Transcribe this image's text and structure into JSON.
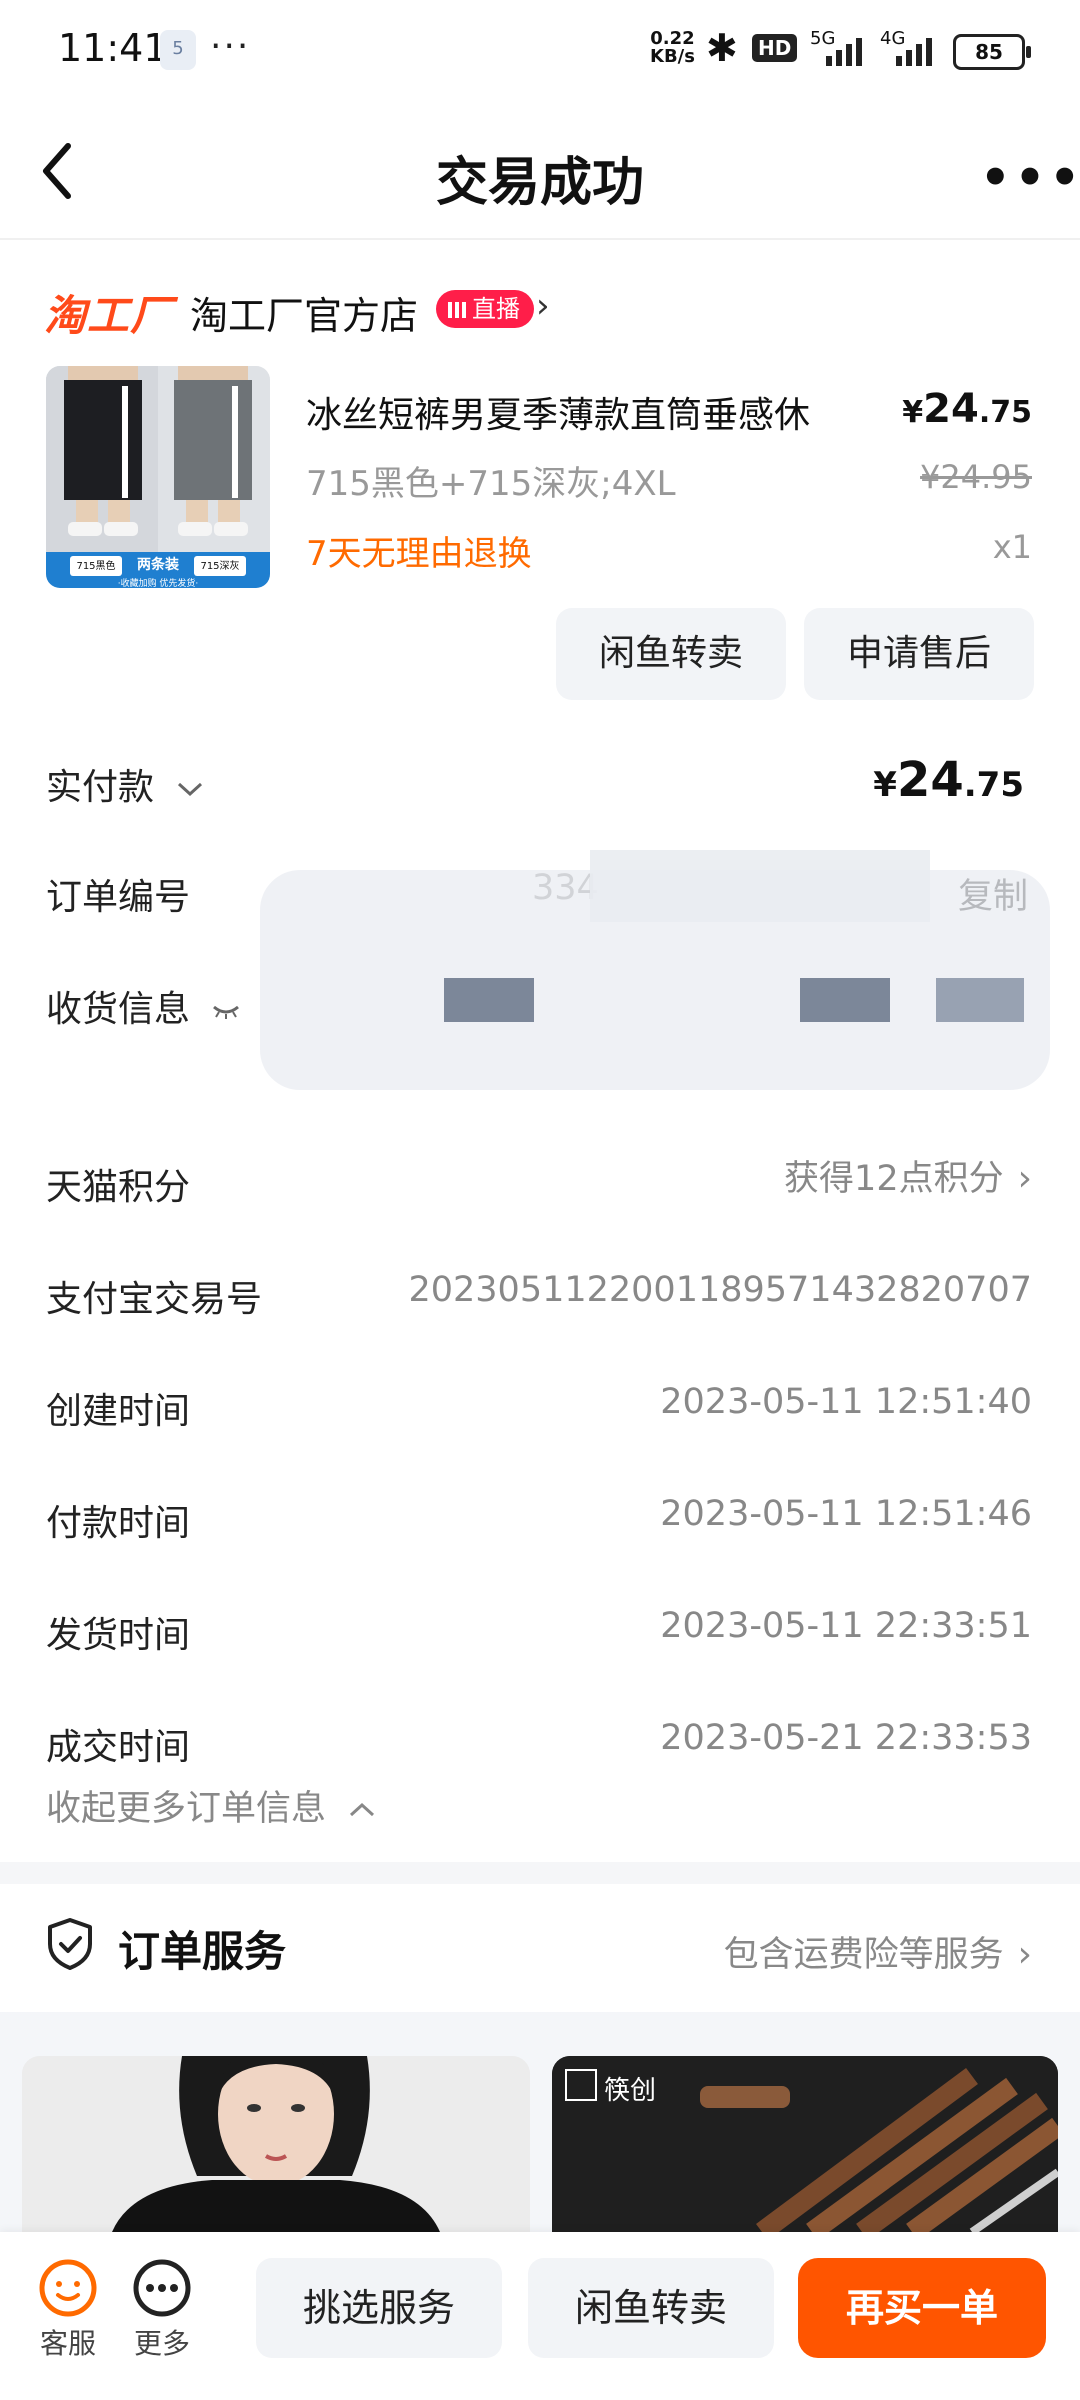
{
  "status_bar": {
    "time": "11:41",
    "sim_badge": "5",
    "net_speed_value": "0.22",
    "net_speed_unit": "KB/s",
    "hd_badge": "HD",
    "signal_1": "5G",
    "signal_2": "4G",
    "battery": "85"
  },
  "header": {
    "title": "交易成功"
  },
  "store": {
    "logo_text": "淘工厂",
    "name": "淘工厂官方店",
    "live_badge": "直播"
  },
  "product": {
    "title": "冰丝短裤男夏季薄款直筒垂感休",
    "price_currency": "¥",
    "price_int": "24",
    "price_dec": ".75",
    "sku": "715黑色+715深灰;4XL",
    "original_price": "¥24.95",
    "returns_label": "7天无理由退换",
    "quantity": "x1",
    "image_label_left": "715黑色",
    "image_label_mid": "两条装",
    "image_label_right": "715深灰",
    "image_caption": "·收藏加购 优先发货·",
    "actions": [
      "闲鱼转卖",
      "申请售后"
    ]
  },
  "order_info": {
    "paid_label": "实付款",
    "paid_currency": "¥",
    "paid_int": "24",
    "paid_dec": ".75",
    "order_no_label": "订单编号",
    "order_no_partial": "334",
    "copy_label": "复制",
    "shipping_label": "收货信息",
    "points_label": "天猫积分",
    "points_value": "获得12点积分",
    "alipay_label": "支付宝交易号",
    "alipay_value": "2023051122001189571432820707",
    "created_label": "创建时间",
    "created_value": "2023-05-11 12:51:40",
    "paid_time_label": "付款时间",
    "paid_time_value": "2023-05-11 12:51:46",
    "shipped_label": "发货时间",
    "shipped_value": "2023-05-11 22:33:51",
    "closed_label": "成交时间",
    "closed_value": "2023-05-21 22:33:53",
    "collapse_label": "收起更多订单信息"
  },
  "service": {
    "title": "订单服务",
    "summary": "包含运费险等服务"
  },
  "feed": {
    "card2_brand": "筷创"
  },
  "bottom_bar": {
    "service_label": "客服",
    "more_label": "更多",
    "choose_service": "挑选服务",
    "resell": "闲鱼转卖",
    "buy_again": "再买一单"
  },
  "colors": {
    "accent_orange": "#ff5500",
    "returns_orange": "#ff6a00",
    "live_red": "#ff1e49",
    "logo_red": "#ff4a1a"
  }
}
